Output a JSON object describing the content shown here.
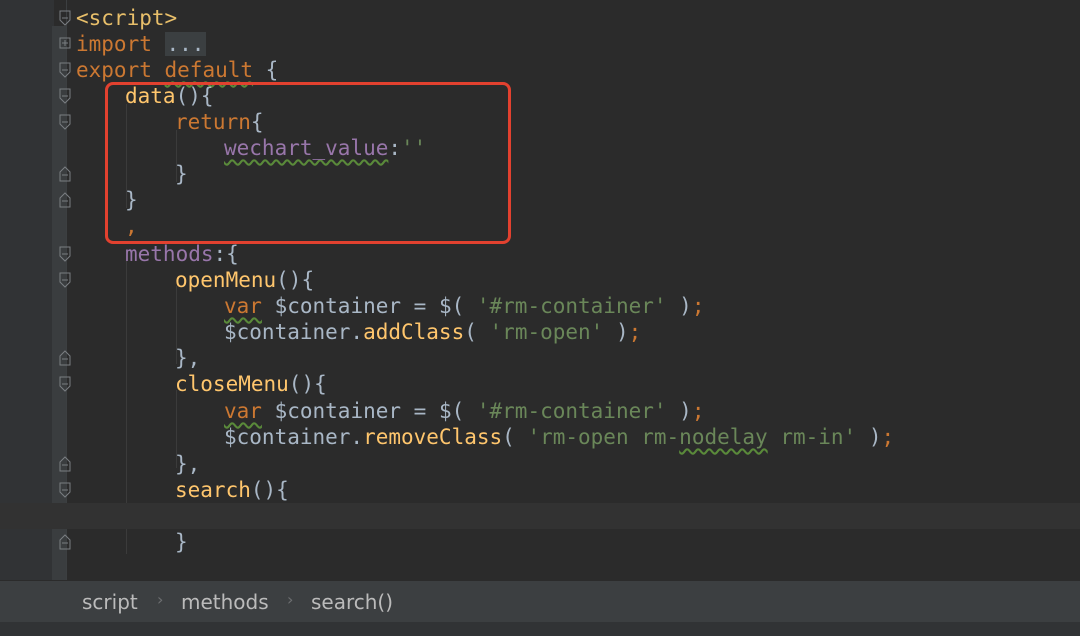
{
  "editor": {
    "lines": {
      "l1": {
        "tag": "<script>"
      },
      "l2": {
        "kw": "import",
        "dots": "..."
      },
      "l3": {
        "kw1": "export",
        "kw2": "default",
        "rest": " {"
      },
      "l4": {
        "fn": "data",
        "rest": "(){"
      },
      "l5": {
        "kw": "return",
        "rest": "{"
      },
      "l6": {
        "prop": "wechart_value",
        "colon": ":",
        "str": "''"
      },
      "l7": {
        "text": "}"
      },
      "l8": {
        "text": "}"
      },
      "l9": {
        "text": ","
      },
      "l10": {
        "prop": "methods",
        "rest": ":{"
      },
      "l11": {
        "fn": "openMenu",
        "rest": "(){"
      },
      "l12": {
        "var": "var",
        "a": " $container = $( ",
        "str": "'#rm-container'",
        "b": " )",
        "semi": ";"
      },
      "l13": {
        "a": "$container.",
        "fn": "addClass",
        "b": "( ",
        "str": "'rm-open'",
        "c": " )",
        "semi": ";"
      },
      "l14": {
        "text": "},"
      },
      "l15": {
        "fn": "closeMenu",
        "rest": "(){"
      },
      "l16": {
        "var": "var",
        "a": " $container = $( ",
        "str": "'#rm-container'",
        "b": " )",
        "semi": ";"
      },
      "l17": {
        "a": "$container.",
        "fn": "removeClass",
        "b": "( ",
        "str1": "'rm-open rm-",
        "str2": "nodelay",
        "str3": " rm-in'",
        "c": " )",
        "semi": ";"
      },
      "l18": {
        "text": "},"
      },
      "l19": {
        "fn": "search",
        "rest": "(){"
      },
      "l20": {
        "text": ""
      },
      "l21": {
        "text": "}"
      }
    }
  },
  "breadcrumb": {
    "items": [
      "script",
      "methods",
      "search()"
    ],
    "separator": "›"
  },
  "colors": {
    "background": "#2b2b2b",
    "keyword": "#cc7832",
    "function": "#ffc66d",
    "property": "#9876aa",
    "string": "#6a8759",
    "highlight_box": "#e2412f"
  }
}
